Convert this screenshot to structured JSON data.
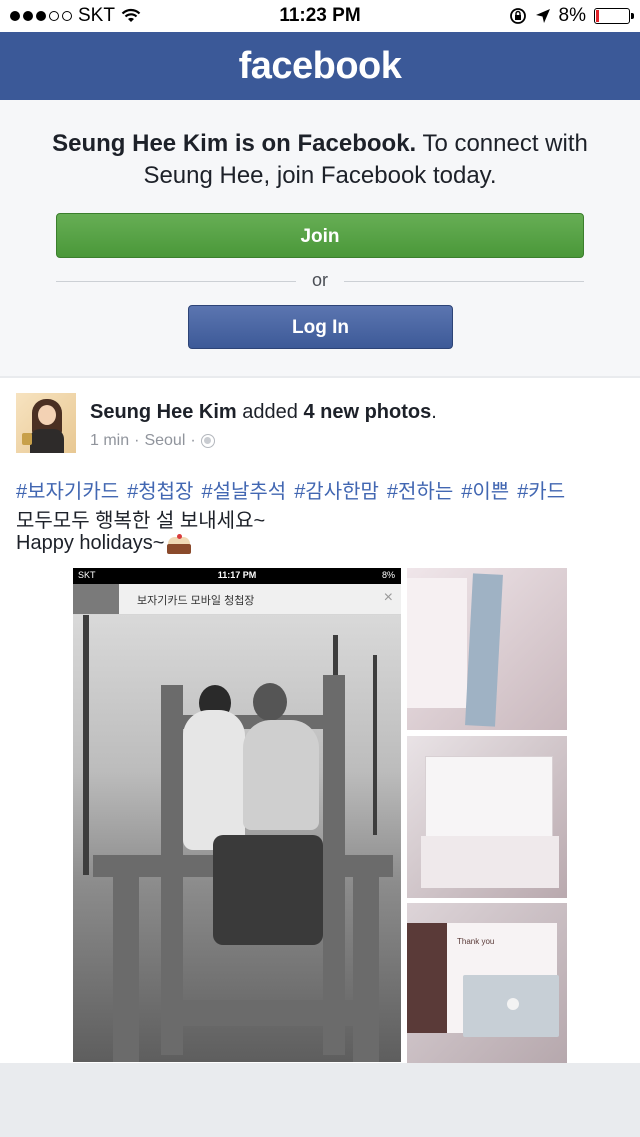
{
  "status_bar": {
    "carrier": "SKT",
    "time": "11:23 PM",
    "battery": "8%",
    "battery_level_percent": 8
  },
  "header": {
    "logo": "facebook",
    "brand_color": "#3b5998"
  },
  "join_prompt": {
    "name_bold": "Seung Hee Kim is on Facebook.",
    "message": " To connect with Seung Hee, join Facebook today.",
    "join_label": "Join",
    "or_label": "or",
    "login_label": "Log In"
  },
  "post": {
    "author": "Seung Hee Kim",
    "action_text": " added ",
    "count_text": "4 new photos",
    "period": ".",
    "time": "1 min",
    "sep1": "·",
    "location": "Seoul",
    "sep2": "·",
    "hashtags": [
      "#보자기카드",
      "#청첩장",
      "#설날추석",
      "#감사한맘",
      "#전하는",
      "#이쁜",
      "#카드"
    ],
    "line2": "모두모두 행복한 설 보내세요~",
    "line3": "Happy holidays~",
    "photo_main": {
      "status_carrier": "SKT",
      "status_time": "11:17 PM",
      "status_battery": "8%",
      "bar_title": "보자기카드 모바일 청첩장",
      "close_glyph": "×"
    },
    "thumb3_text": "Thank you"
  }
}
